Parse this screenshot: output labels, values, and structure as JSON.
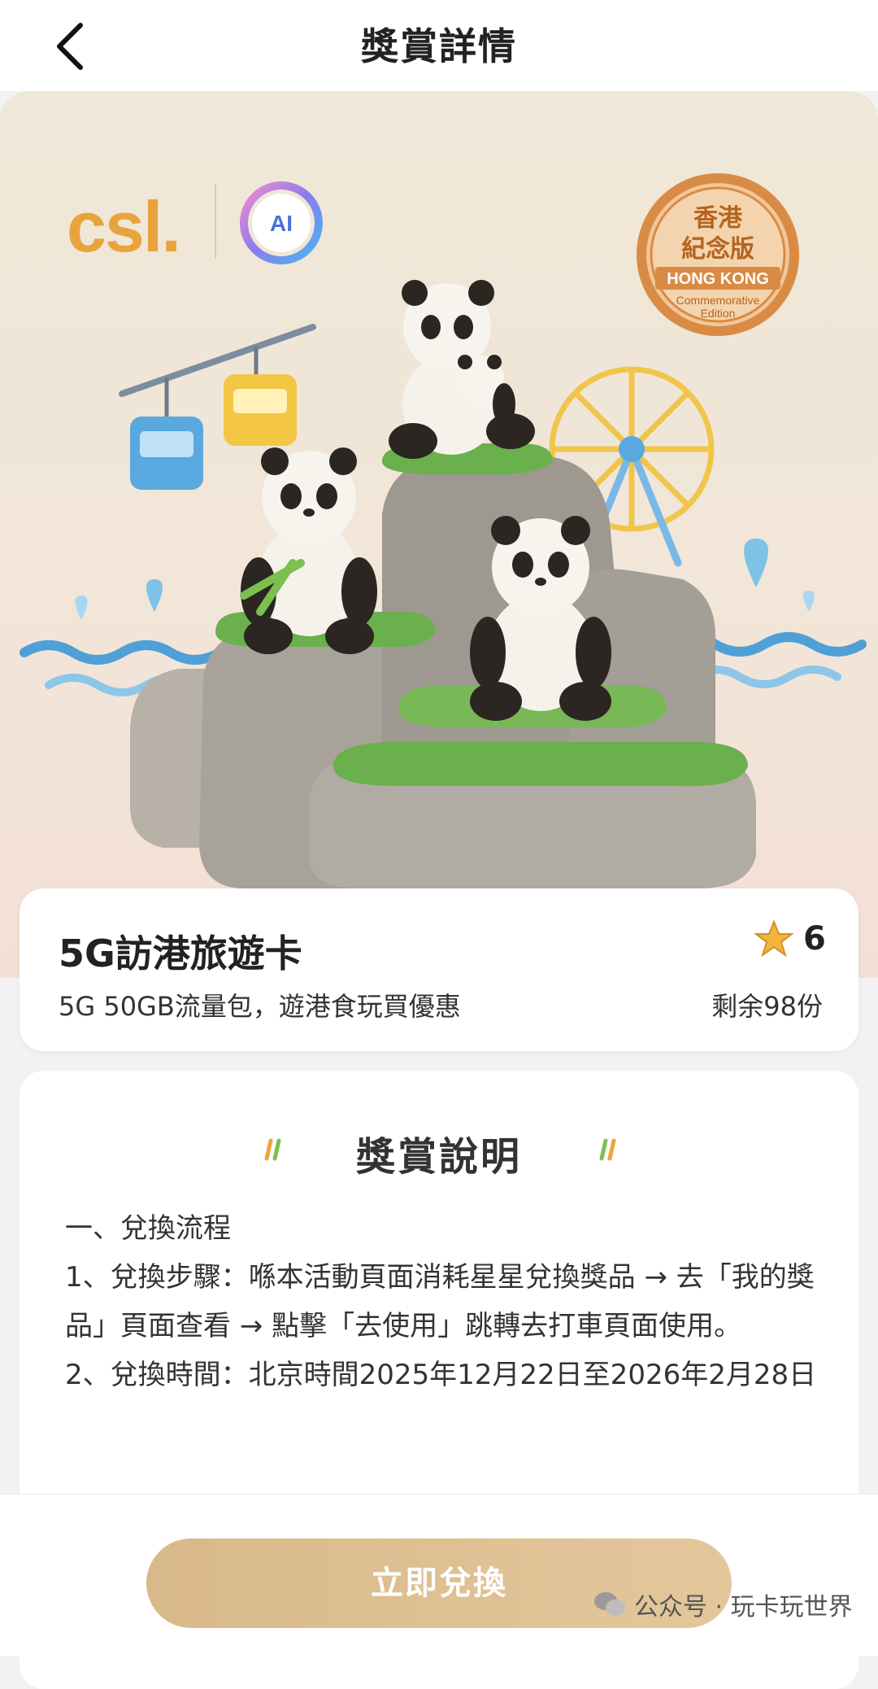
{
  "header": {
    "title": "獎賞詳情"
  },
  "hero": {
    "brand": "csl.",
    "ai_badge": "AI",
    "seal": {
      "line1": "香港",
      "line2": "紀念版",
      "line3": "HONG KONG",
      "line4": "Commemorative",
      "line5": "Edition"
    }
  },
  "reward": {
    "name": "5G訪港旅遊卡",
    "description": "5G 50GB流量包，遊港食玩買優惠",
    "stars": "6",
    "remaining": "剩余98份"
  },
  "details": {
    "title": "獎賞說明",
    "lines": [
      "一、兌換流程",
      "1、兌換步驟：喺本活動頁面消耗星星兌換獎品 → 去「我的獎品」頁面查看 → 點擊「去使用」跳轉去打車頁面使用。",
      "2、兌換時間：北京時間2025年12月22日至2026年2月28日"
    ]
  },
  "action": {
    "redeem_label": "立即兌換"
  },
  "watermark": {
    "text": "公众号 · 玩卡玩世界"
  },
  "colors": {
    "brand_orange": "#e8a43c",
    "button": "#dcbd8f",
    "seal": "#d98b45"
  }
}
